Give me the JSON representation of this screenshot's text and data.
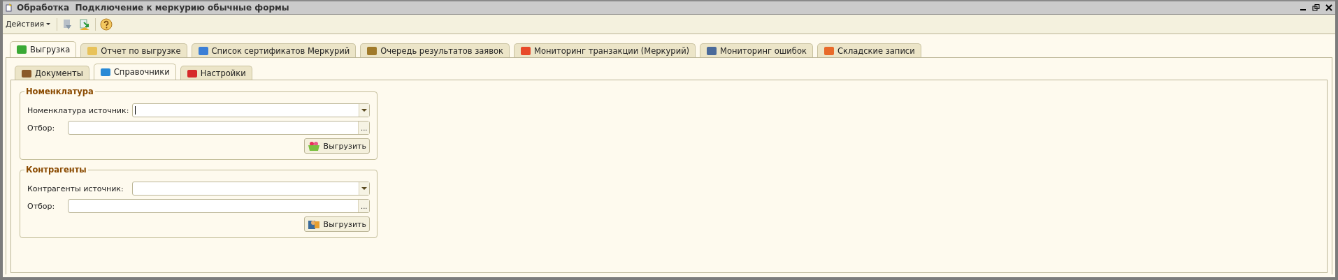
{
  "window": {
    "title": "Обработка  Подключение к меркурию обычные формы"
  },
  "toolbar": {
    "menu": "Действия"
  },
  "tabs": [
    {
      "label": "Выгрузка",
      "selected": true
    },
    {
      "label": "Отчет по выгрузке",
      "selected": false
    },
    {
      "label": "Список сертификатов Меркурий",
      "selected": false
    },
    {
      "label": "Очередь результатов заявок",
      "selected": false
    },
    {
      "label": "Мониторинг транзакции (Меркурий)",
      "selected": false
    },
    {
      "label": "Мониторинг ошибок",
      "selected": false
    },
    {
      "label": "Складские записи",
      "selected": false
    }
  ],
  "subtabs": [
    {
      "label": "Документы",
      "selected": false
    },
    {
      "label": "Справочники",
      "selected": true
    },
    {
      "label": "Настройки",
      "selected": false
    }
  ],
  "groups": [
    {
      "title": "Номенклатура",
      "fields": [
        {
          "label": "Номенклатура источник:",
          "kind": "dropdown",
          "focused": true
        },
        {
          "label": "Отбор:",
          "kind": "choice",
          "button": "...",
          "focused": false
        }
      ],
      "button": "Выгрузить"
    },
    {
      "title": "Контрагенты",
      "fields": [
        {
          "label": "Контрагенты источник:",
          "kind": "dropdown",
          "focused": false
        },
        {
          "label": "Отбор:",
          "kind": "choice",
          "button": "...",
          "focused": false
        }
      ],
      "button": "Выгрузить"
    }
  ]
}
